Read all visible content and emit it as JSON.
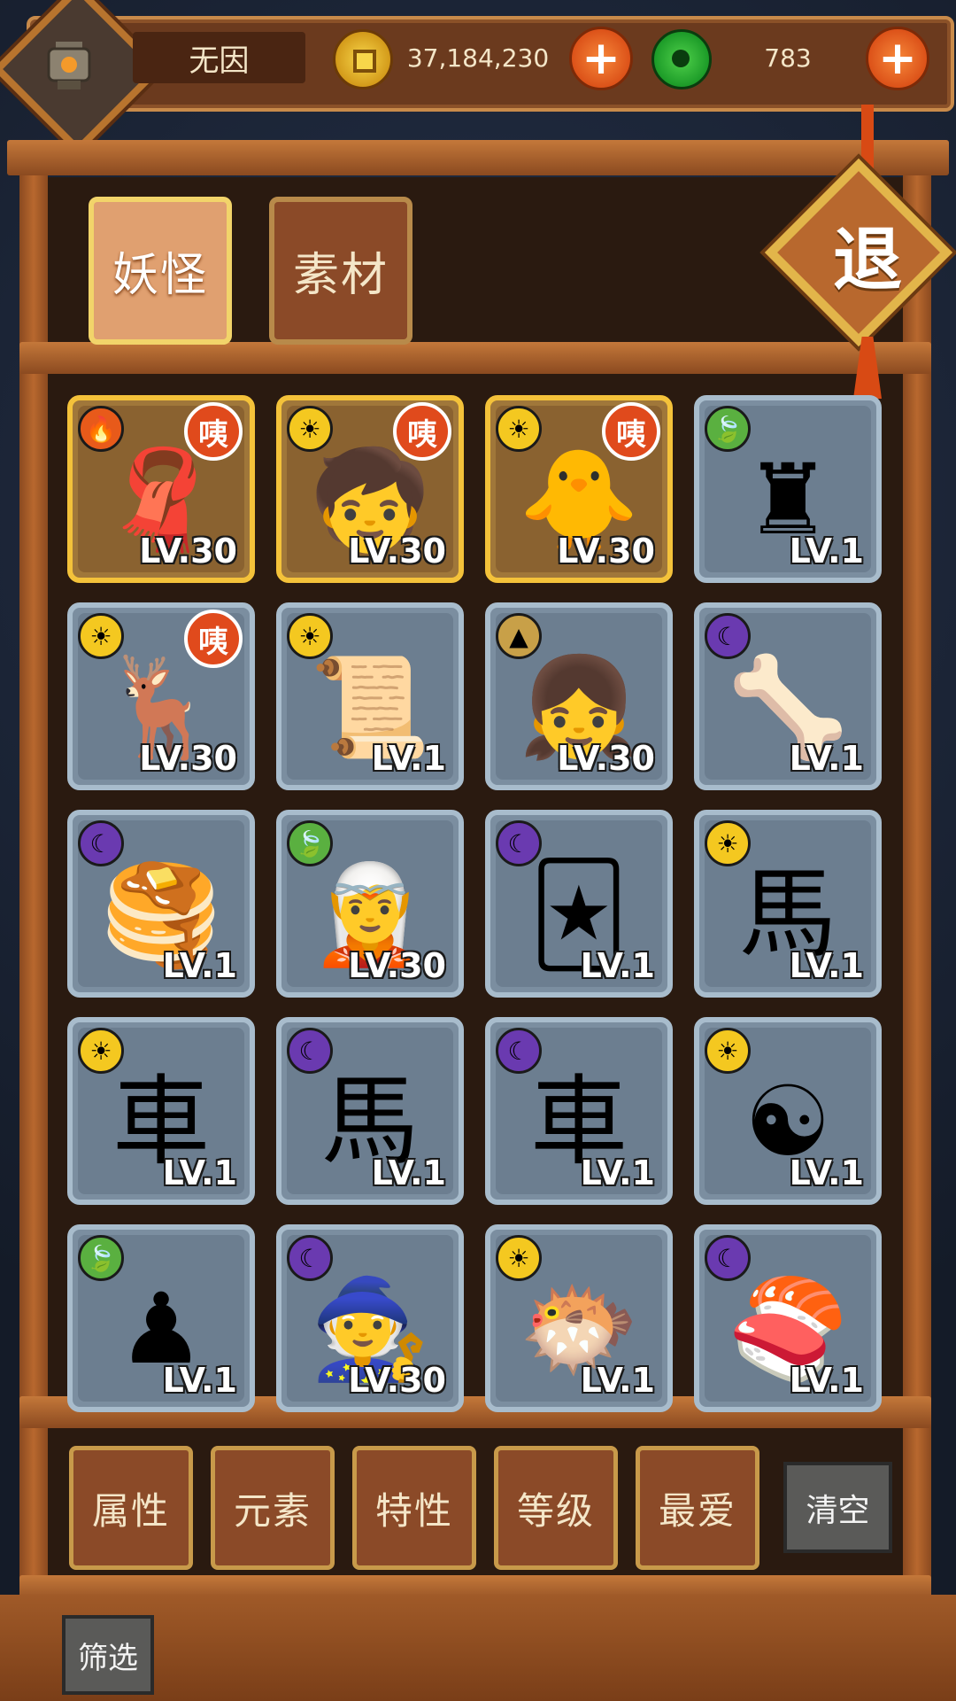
{
  "header": {
    "player_name": "无因",
    "gold_amount": "37,184,230",
    "jade_amount": "783",
    "add_label": "+"
  },
  "tabs": [
    {
      "label": "妖怪",
      "active": true
    },
    {
      "label": "素材",
      "active": false
    }
  ],
  "exit_label": "退",
  "monsters": [
    {
      "element": "fire",
      "icon": "🧣",
      "level": "LV.30",
      "badge": "咦",
      "gold": true
    },
    {
      "element": "sun",
      "icon": "🧒",
      "level": "LV.30",
      "badge": "咦",
      "gold": true
    },
    {
      "element": "sun",
      "icon": "🐥",
      "level": "LV.30",
      "badge": "咦",
      "gold": true
    },
    {
      "element": "leaf",
      "icon": "♜",
      "level": "LV.1",
      "badge": "",
      "gold": false
    },
    {
      "element": "sun",
      "icon": "🦌",
      "level": "LV.30",
      "badge": "咦",
      "gold": false
    },
    {
      "element": "sun",
      "icon": "📜",
      "level": "LV.1",
      "badge": "",
      "gold": false
    },
    {
      "element": "mountain",
      "icon": "👧",
      "level": "LV.30",
      "badge": "",
      "gold": false
    },
    {
      "element": "moon",
      "icon": "🦴",
      "level": "LV.1",
      "badge": "",
      "gold": false
    },
    {
      "element": "moon",
      "icon": "🥞",
      "level": "LV.1",
      "badge": "",
      "gold": false
    },
    {
      "element": "leaf",
      "icon": "🧝",
      "level": "LV.30",
      "badge": "",
      "gold": false
    },
    {
      "element": "moon",
      "icon": "🃏",
      "level": "LV.1",
      "badge": "",
      "gold": false
    },
    {
      "element": "sun",
      "icon": "馬",
      "level": "LV.1",
      "badge": "",
      "gold": false
    },
    {
      "element": "sun",
      "icon": "車",
      "level": "LV.1",
      "badge": "",
      "gold": false
    },
    {
      "element": "moon",
      "icon": "馬",
      "level": "LV.1",
      "badge": "",
      "gold": false
    },
    {
      "element": "moon",
      "icon": "車",
      "level": "LV.1",
      "badge": "",
      "gold": false
    },
    {
      "element": "sun",
      "icon": "☯",
      "level": "LV.1",
      "badge": "",
      "gold": false
    },
    {
      "element": "leaf",
      "icon": "♟",
      "level": "LV.1",
      "badge": "",
      "gold": false
    },
    {
      "element": "moon",
      "icon": "🧙",
      "level": "LV.30",
      "badge": "",
      "gold": false
    },
    {
      "element": "sun",
      "icon": "🐡",
      "level": "LV.1",
      "badge": "",
      "gold": false
    },
    {
      "element": "moon",
      "icon": "🍣",
      "level": "LV.1",
      "badge": "",
      "gold": false
    }
  ],
  "element_colors": {
    "fire": "#e85a1a",
    "sun": "#f4c820",
    "leaf": "#5ab040",
    "moon": "#6a3ab0",
    "mountain": "#c8a048"
  },
  "filters": [
    "属性",
    "元素",
    "特性",
    "等级",
    "最爱"
  ],
  "clear_label": "清空",
  "screen_label": "筛选"
}
